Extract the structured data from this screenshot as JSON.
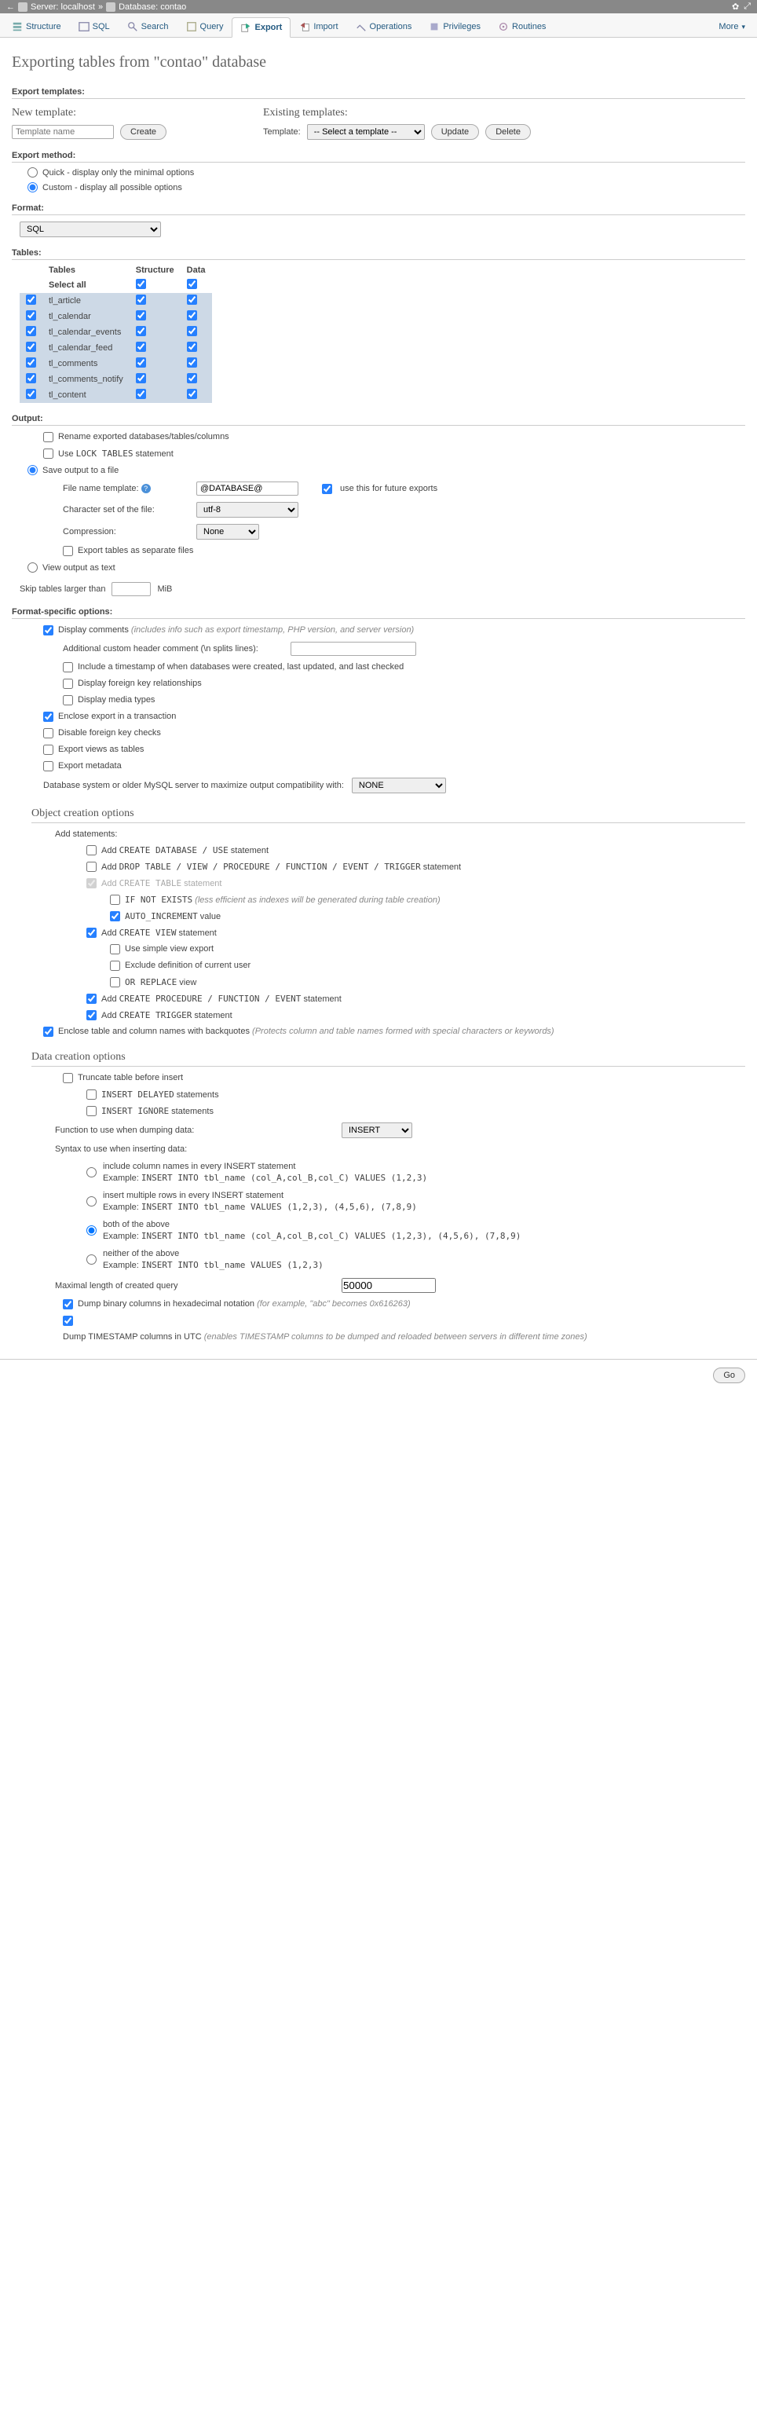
{
  "topbar": {
    "server": "Server: localhost",
    "database": "Database: contao"
  },
  "tabs": {
    "structure": "Structure",
    "sql": "SQL",
    "search": "Search",
    "query": "Query",
    "export": "Export",
    "import": "Import",
    "operations": "Operations",
    "privileges": "Privileges",
    "routines": "Routines",
    "more": "More"
  },
  "title": "Exporting tables from \"contao\" database",
  "export_templates_heading": "Export templates:",
  "new_template_heading": "New template:",
  "template_placeholder": "Template name",
  "create_btn": "Create",
  "existing_templates_heading": "Existing templates:",
  "template_label": "Template:",
  "template_select_placeholder": "-- Select a template --",
  "update_btn": "Update",
  "delete_btn": "Delete",
  "method_heading": "Export method:",
  "method_quick": "Quick - display only the minimal options",
  "method_custom": "Custom - display all possible options",
  "format_heading": "Format:",
  "format_value": "SQL",
  "tables_heading": "Tables:",
  "tables": {
    "cols": {
      "tables": "Tables",
      "structure": "Structure",
      "data": "Data"
    },
    "select_all": "Select all",
    "rows": [
      "tl_article",
      "tl_calendar",
      "tl_calendar_events",
      "tl_calendar_feed",
      "tl_comments",
      "tl_comments_notify",
      "tl_content"
    ]
  },
  "output_heading": "Output:",
  "rename_exported": "Rename exported databases/tables/columns",
  "lock_tables": "Use LOCK TABLES statement",
  "save_to_file": "Save output to a file",
  "file_name_template": "File name template:",
  "file_name_value": "@DATABASE@",
  "use_future": "use this for future exports",
  "charset": "Character set of the file:",
  "charset_value": "utf-8",
  "compression": "Compression:",
  "compression_value": "None",
  "separate_files": "Export tables as separate files",
  "view_as_text": "View output as text",
  "skip_tables": "Skip tables larger than",
  "mib": "MiB",
  "fso_heading": "Format-specific options:",
  "display_comments": "Display comments",
  "display_comments_note": "(includes info such as export timestamp, PHP version, and server version)",
  "additional_header": "Additional custom header comment (\\n splits lines):",
  "include_timestamp": "Include a timestamp of when databases were created, last updated, and last checked",
  "display_fk": "Display foreign key relationships",
  "display_media": "Display media types",
  "enclose_transaction": "Enclose export in a transaction",
  "disable_fk": "Disable foreign key checks",
  "export_views": "Export views as tables",
  "export_metadata": "Export metadata",
  "db_compat": "Database system or older MySQL server to maximize output compatibility with:",
  "db_compat_value": "NONE",
  "obj_creation_heading": "Object creation options",
  "add_statements": "Add statements:",
  "add_create_db": "Add CREATE DATABASE / USE statement",
  "add_drop": "Add DROP TABLE / VIEW / PROCEDURE / FUNCTION / EVENT / TRIGGER statement",
  "add_create_table": "Add CREATE TABLE statement",
  "if_not_exists": "IF NOT EXISTS",
  "if_not_exists_note": "(less efficient as indexes will be generated during table creation)",
  "auto_increment": "AUTO_INCREMENT value",
  "add_create_view": "Add CREATE VIEW statement",
  "simple_view": "Use simple view export",
  "exclude_definer": "Exclude definition of current user",
  "or_replace": "OR REPLACE view",
  "add_create_proc": "Add CREATE PROCEDURE / FUNCTION / EVENT statement",
  "add_create_trigger": "Add CREATE TRIGGER statement",
  "enclose_backquotes": "Enclose table and column names with backquotes",
  "enclose_backquotes_note": "(Protects column and table names formed with special characters or keywords)",
  "data_creation_heading": "Data creation options",
  "truncate": "Truncate table before insert",
  "insert_delayed": "INSERT DELAYED statements",
  "insert_ignore": "INSERT IGNORE statements",
  "fn_dump": "Function to use when dumping data:",
  "fn_dump_value": "INSERT",
  "syntax_insert": "Syntax to use when inserting data:",
  "r1a": "include column names in every INSERT statement",
  "r1b": "Example: INSERT INTO tbl_name (col_A,col_B,col_C) VALUES (1,2,3)",
  "r2a": "insert multiple rows in every INSERT statement",
  "r2b": "Example: INSERT INTO tbl_name VALUES (1,2,3), (4,5,6), (7,8,9)",
  "r3a": "both of the above",
  "r3b": "Example: INSERT INTO tbl_name (col_A,col_B,col_C) VALUES (1,2,3), (4,5,6), (7,8,9)",
  "r4a": "neither of the above",
  "r4b": "Example: INSERT INTO tbl_name VALUES (1,2,3)",
  "max_len": "Maximal length of created query",
  "max_len_value": "50000",
  "dump_binary": "Dump binary columns in hexadecimal notation",
  "dump_binary_note": "(for example, \"abc\" becomes 0x616263)",
  "dump_ts": "Dump TIMESTAMP columns in UTC",
  "dump_ts_note": "(enables TIMESTAMP columns to be dumped and reloaded between servers in different time zones)",
  "go": "Go"
}
